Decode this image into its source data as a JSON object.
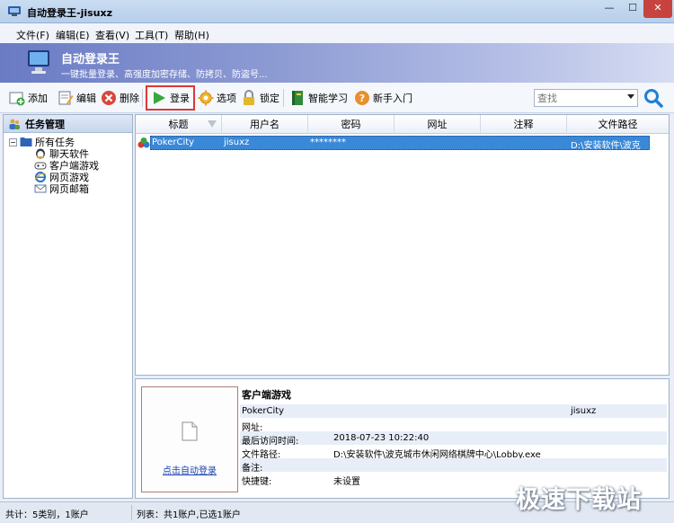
{
  "window": {
    "title": "自动登录王-jisuxz",
    "min_label": "—",
    "max_label": "☐",
    "close_label": "✕"
  },
  "menu": {
    "items": [
      {
        "label": "文件(F)"
      },
      {
        "label": "编辑(E)"
      },
      {
        "label": "查看(V)"
      },
      {
        "label": "工具(T)"
      },
      {
        "label": "帮助(H)"
      }
    ]
  },
  "banner": {
    "title": "自动登录王",
    "subtitle": "一键批量登录、高强度加密存储、防拷贝、防盗号..."
  },
  "toolbar": {
    "add": "添加",
    "edit": "编辑",
    "delete": "删除",
    "login": "登录",
    "options": "选项",
    "lock": "锁定",
    "smart_learn": "智能学习",
    "beginner": "新手入门",
    "search_placeholder": "查找"
  },
  "tree": {
    "header": "任务管理",
    "root": "所有任务",
    "items": [
      {
        "label": "聊天软件",
        "icon": "chat-icon"
      },
      {
        "label": "客户端游戏",
        "icon": "gamepad-icon"
      },
      {
        "label": "网页游戏",
        "icon": "ie-icon"
      },
      {
        "label": "网页邮箱",
        "icon": "mail-icon"
      }
    ]
  },
  "list": {
    "columns": [
      "标题",
      "用户名",
      "密码",
      "网址",
      "注释",
      "文件路径"
    ],
    "rows": [
      {
        "title": "PokerCity",
        "username": "jisuxz",
        "password": "********",
        "url": "",
        "note": "",
        "path": "D:\\安装软件\\波克"
      }
    ]
  },
  "detail": {
    "preview_link": "点击自动登录",
    "category": "客户端游戏",
    "title": "PokerCity",
    "username": "jisuxz",
    "url_label": "网址:",
    "url_value": "",
    "last_visit_label": "最后访问时间:",
    "last_visit_value": "2018-07-23 10:22:40",
    "path_label": "文件路径:",
    "path_value": "D:\\安装软件\\波克城市休闲网络棋牌中心\\Lobby.exe",
    "note_label": "备注:",
    "note_value": "",
    "hotkey_label": "快捷键:",
    "hotkey_value": "未设置"
  },
  "status": {
    "left": "共计：5类别，1账户",
    "right": "列表：共1账户,已选1账户"
  },
  "watermark": "极速下载站"
}
